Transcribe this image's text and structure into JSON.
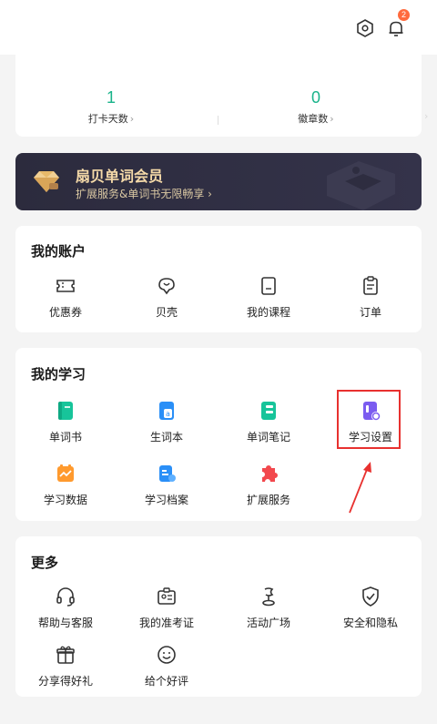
{
  "header": {
    "notification_count": "2",
    "icons": [
      "hexagon-settings-icon",
      "bell-icon"
    ]
  },
  "stats": {
    "checkin_days_value": "1",
    "checkin_days_label": "打卡天数",
    "badges_value": "0",
    "badges_label": "徽章数",
    "accent": "#19b38a"
  },
  "vip": {
    "title": "扇贝单词会员",
    "subtitle": "扩展服务&单词书无限畅享",
    "title_color": "#f4d9a8",
    "bg_color": "#2c2b3d"
  },
  "account": {
    "title": "我的账户",
    "items": [
      {
        "label": "优惠券",
        "icon": "coupon-icon"
      },
      {
        "label": "贝壳",
        "icon": "shell-icon"
      },
      {
        "label": "我的课程",
        "icon": "course-book-icon"
      },
      {
        "label": "订单",
        "icon": "order-icon"
      }
    ]
  },
  "study": {
    "title": "我的学习",
    "items": [
      {
        "label": "单词书",
        "icon": "wordbook-icon"
      },
      {
        "label": "生词本",
        "icon": "vocab-notebook-icon"
      },
      {
        "label": "单词笔记",
        "icon": "word-notes-icon"
      },
      {
        "label": "学习设置",
        "icon": "study-settings-icon"
      },
      {
        "label": "学习数据",
        "icon": "study-data-icon"
      },
      {
        "label": "学习档案",
        "icon": "study-archive-icon"
      },
      {
        "label": "扩展服务",
        "icon": "extension-puzzle-icon"
      }
    ]
  },
  "more": {
    "title": "更多",
    "items": [
      {
        "label": "帮助与客服",
        "icon": "headset-icon"
      },
      {
        "label": "我的准考证",
        "icon": "admission-ticket-icon"
      },
      {
        "label": "活动广场",
        "icon": "activity-icon"
      },
      {
        "label": "安全和隐私",
        "icon": "shield-icon"
      },
      {
        "label": "分享得好礼",
        "icon": "gift-icon"
      },
      {
        "label": "给个好评",
        "icon": "smile-icon"
      }
    ]
  },
  "annotation": {
    "highlight_color": "#e8312f"
  }
}
